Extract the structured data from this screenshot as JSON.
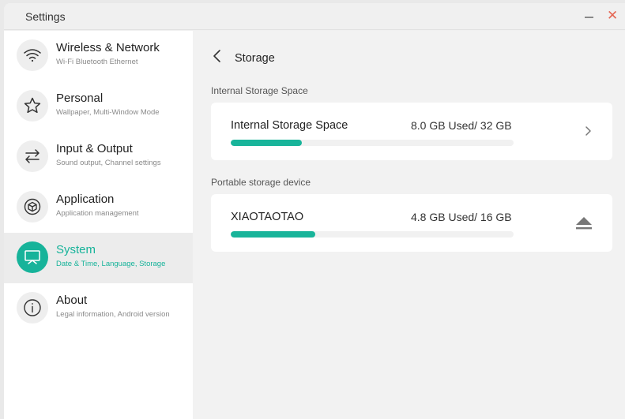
{
  "window": {
    "title": "Settings"
  },
  "colors": {
    "accent": "#17b39a",
    "close": "#e46654"
  },
  "sidebar": {
    "items": [
      {
        "title": "Wireless & Network",
        "subtitle": "Wi-Fi Bluetooth Ethernet",
        "icon": "wifi-icon"
      },
      {
        "title": "Personal",
        "subtitle": "Wallpaper, Multi-Window Mode",
        "icon": "star-icon"
      },
      {
        "title": "Input & Output",
        "subtitle": "Sound output, Channel settings",
        "icon": "arrows-icon"
      },
      {
        "title": "Application",
        "subtitle": "Application management",
        "icon": "cube-icon"
      },
      {
        "title": "System",
        "subtitle": "Date & Time, Language, Storage",
        "icon": "monitor-icon",
        "active": true
      },
      {
        "title": "About",
        "subtitle": "Legal information, Android version",
        "icon": "info-icon"
      }
    ]
  },
  "main": {
    "title": "Storage",
    "internal": {
      "section_label": "Internal Storage Space",
      "name": "Internal Storage Space",
      "usage": "8.0 GB Used/ 32 GB",
      "used_fraction": 0.25
    },
    "portable": {
      "section_label": "Portable storage device",
      "name": "XIAOTAOTAO",
      "usage": "4.8 GB Used/ 16 GB",
      "used_fraction": 0.3
    }
  }
}
